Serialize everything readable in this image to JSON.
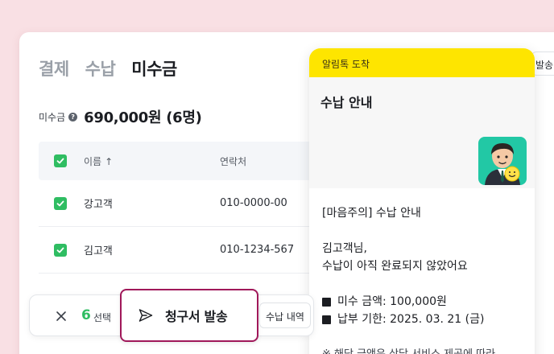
{
  "tabs": [
    {
      "label": "결제",
      "active": false
    },
    {
      "label": "수납",
      "active": false
    },
    {
      "label": "미수금",
      "active": true
    }
  ],
  "summary": {
    "label": "미수금",
    "value": "690,000원 (6명)"
  },
  "table": {
    "headers": {
      "name": "이름",
      "contact": "연락처"
    },
    "rows": [
      {
        "name": "강고객",
        "contact": "010-0000-00",
        "checked": true
      },
      {
        "name": "김고객",
        "contact": "010-1234-567",
        "checked": true
      }
    ]
  },
  "notification": {
    "header": "알림톡 도착",
    "title": "수납 안내",
    "greeting_line": "[마음주의] 수납 안내",
    "recipient": "김고객님,",
    "message": "수납이 아직 완료되지 않았어요",
    "amount_line": "미수 금액: 100,000원",
    "due_line": "납부 기한: 2025. 03. 21 (금)",
    "footnote": "※ 해당 금액은 상담 서비스 제공에 따라"
  },
  "action_bar": {
    "selected_count": "6",
    "selected_label": "선택",
    "send_label": "청구서 발송",
    "history_label": "수납 내역"
  },
  "partial_button": {
    "label": "발송"
  },
  "colors": {
    "background": "#f9e0e4",
    "accent_green": "#2fbd62",
    "kakao_yellow": "#fee500",
    "highlight_border": "#a0185a"
  },
  "icons": {
    "checkbox": "check-icon",
    "help": "question-circle-icon",
    "sort": "arrow-up-icon",
    "close": "close-icon",
    "send": "paper-plane-icon",
    "bullet": "square-bullet-icon"
  }
}
